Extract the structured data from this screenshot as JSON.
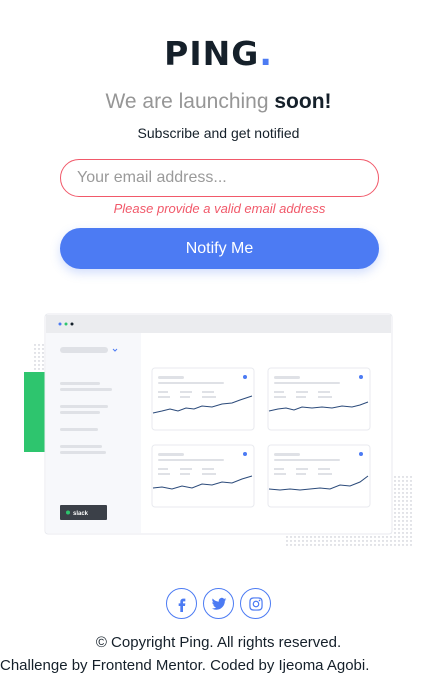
{
  "brand": {
    "name": "PING",
    "dot": "."
  },
  "headline": {
    "lead": "We are launching ",
    "emphasis": "soon!"
  },
  "subhead": "Subscribe and get notified",
  "form": {
    "email_placeholder": "Your email address...",
    "error": "Please provide a valid email address",
    "submit_label": "Notify Me"
  },
  "illustration": {
    "badge": "slack"
  },
  "social": [
    {
      "name": "facebook",
      "icon": "facebook-icon"
    },
    {
      "name": "twitter",
      "icon": "twitter-icon"
    },
    {
      "name": "instagram",
      "icon": "instagram-icon"
    }
  ],
  "footer": {
    "copyright": "© Copyright Ping. All rights reserved.",
    "attribution": "Challenge by Frontend Mentor. Coded by Ijeoma Agobi."
  },
  "colors": {
    "accent": "#4c7bf3",
    "error": "#f1596a",
    "text": "#15202a",
    "muted": "#969696",
    "green": "#2ec56e"
  }
}
